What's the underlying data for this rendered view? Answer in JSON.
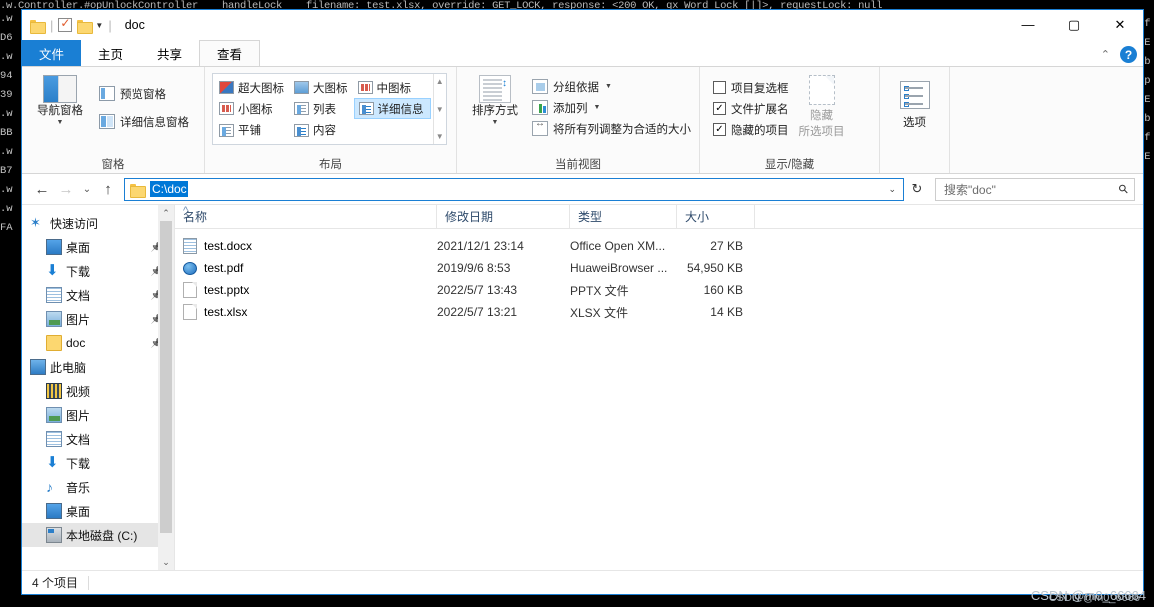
{
  "console": {
    "top_line": ".w.Controller.#opUnlockController    handleLock    filename: test.xlsx, override: GET_LOCK, response: <200 OK, qx Word Lock [|]>, requestLock: null",
    "left_fragments": [
      ".w",
      "D6",
      ".w",
      "94",
      "39",
      ".w",
      "BB",
      ".w",
      "B7",
      ".w",
      ".w",
      "FA"
    ],
    "right_fragments": [
      "'f",
      "'E",
      "'b",
      "sp",
      "'E",
      "'b",
      "'f",
      "'E"
    ]
  },
  "titlebar": {
    "title": "doc",
    "quick_access": {
      "folder_icon": "folder-icon",
      "properties_icon": "properties-icon",
      "new_folder_icon": "new-folder-icon",
      "caret": "▾"
    },
    "minimize": "—",
    "maximize": "▢",
    "close": "✕"
  },
  "tabs": {
    "file": "文件",
    "home": "主页",
    "share": "共享",
    "view": "查看",
    "collapse_ribbon": "⌃",
    "help": "?"
  },
  "ribbon": {
    "groups": [
      {
        "label": "窗格",
        "big_button": "导航窗格",
        "items": [
          "预览窗格",
          "详细信息窗格"
        ]
      },
      {
        "label": "布局",
        "gallery": [
          {
            "label": "超大图标",
            "selected": false
          },
          {
            "label": "大图标",
            "selected": false
          },
          {
            "label": "中图标",
            "selected": false
          },
          {
            "label": "小图标",
            "selected": false
          },
          {
            "label": "列表",
            "selected": false
          },
          {
            "label": "详细信息",
            "selected": true
          },
          {
            "label": "平铺",
            "selected": false
          },
          {
            "label": "内容",
            "selected": false
          }
        ]
      },
      {
        "label": "当前视图",
        "big_button": "排序方式",
        "items": [
          "分组依据",
          "添加列",
          "将所有列调整为合适的大小"
        ]
      },
      {
        "label": "显示/隐藏",
        "checkboxes": [
          {
            "label": "项目复选框",
            "checked": false
          },
          {
            "label": "文件扩展名",
            "checked": true
          },
          {
            "label": "隐藏的项目",
            "checked": true
          }
        ],
        "hide_button": {
          "line1": "隐藏",
          "line2": "所选项目"
        }
      },
      {
        "label": "",
        "big_button": "选项"
      }
    ]
  },
  "address": {
    "back": "←",
    "forward": "→",
    "recent": "⌄",
    "up": "↑",
    "path": "C:\\doc",
    "dropdown": "⌄",
    "refresh": "↻"
  },
  "search": {
    "placeholder": "搜索\"doc\"",
    "icon": "search-icon"
  },
  "navpane": {
    "items": [
      {
        "label": "快速访问",
        "icon": "star-pin-icon",
        "level": 1,
        "pinned": false,
        "selected": false
      },
      {
        "label": "桌面",
        "icon": "desktop-icon",
        "level": 2,
        "pinned": true,
        "selected": false
      },
      {
        "label": "下载",
        "icon": "download-icon",
        "level": 2,
        "pinned": true,
        "selected": false
      },
      {
        "label": "文档",
        "icon": "documents-icon",
        "level": 2,
        "pinned": true,
        "selected": false
      },
      {
        "label": "图片",
        "icon": "pictures-icon",
        "level": 2,
        "pinned": true,
        "selected": false
      },
      {
        "label": "doc",
        "icon": "folder-icon",
        "level": 2,
        "pinned": true,
        "selected": false
      },
      {
        "label": "此电脑",
        "icon": "this-pc-icon",
        "level": 1,
        "pinned": false,
        "selected": false
      },
      {
        "label": "视频",
        "icon": "video-icon",
        "level": 2,
        "pinned": false,
        "selected": false
      },
      {
        "label": "图片",
        "icon": "pictures-icon",
        "level": 2,
        "pinned": false,
        "selected": false
      },
      {
        "label": "文档",
        "icon": "documents-icon",
        "level": 2,
        "pinned": false,
        "selected": false
      },
      {
        "label": "下载",
        "icon": "download-icon",
        "level": 2,
        "pinned": false,
        "selected": false
      },
      {
        "label": "音乐",
        "icon": "music-icon",
        "level": 2,
        "pinned": false,
        "selected": false
      },
      {
        "label": "桌面",
        "icon": "desktop-icon",
        "level": 2,
        "pinned": false,
        "selected": false
      },
      {
        "label": "本地磁盘 (C:)",
        "icon": "disk-icon",
        "level": 2,
        "pinned": false,
        "selected": true
      }
    ]
  },
  "filelist": {
    "columns": [
      "名称",
      "修改日期",
      "类型",
      "大小"
    ],
    "sorted_column": "名称",
    "rows": [
      {
        "name": "test.docx",
        "date": "2021/12/1 23:14",
        "type": "Office Open XM...",
        "size": "27 KB",
        "icon": "word-doc-icon"
      },
      {
        "name": "test.pdf",
        "date": "2019/9/6 8:53",
        "type": "HuaweiBrowser ...",
        "size": "54,950 KB",
        "icon": "browser-pdf-icon"
      },
      {
        "name": "test.pptx",
        "date": "2022/5/7 13:43",
        "type": "PPTX 文件",
        "size": "160 KB",
        "icon": "blank-file-icon"
      },
      {
        "name": "test.xlsx",
        "date": "2022/5/7 13:21",
        "type": "XLSX 文件",
        "size": "14 KB",
        "icon": "blank-file-icon"
      }
    ]
  },
  "statusbar": {
    "item_count": "4 个项目"
  },
  "watermark": {
    "line1": "CSDN @m0_66664",
    "line2": "CSDN @m0_6666"
  }
}
